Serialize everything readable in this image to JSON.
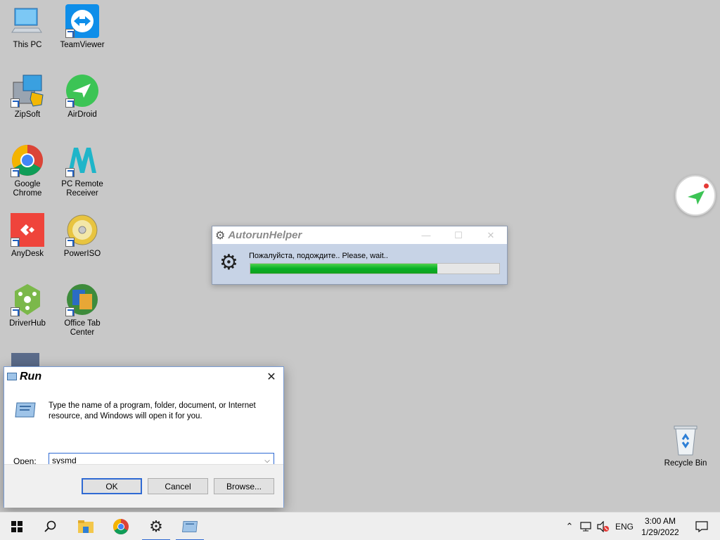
{
  "desktop": {
    "icons": [
      {
        "label": "This PC"
      },
      {
        "label": "TeamViewer"
      },
      {
        "label": "ZipSoft"
      },
      {
        "label": "AirDroid"
      },
      {
        "label": "Google Chrome"
      },
      {
        "label": "PC Remote Receiver"
      },
      {
        "label": "AnyDesk"
      },
      {
        "label": "PowerISO"
      },
      {
        "label": "DriverHub"
      },
      {
        "label": "Office Tab Center"
      },
      {
        "label": "Recycle Bin"
      }
    ]
  },
  "autorun": {
    "title": "AutorunHelper",
    "message": "Пожалуйста, подождите.. Please, wait..",
    "progress": 0.75,
    "progress_color": "#06b025"
  },
  "run_dialog": {
    "title": "Run",
    "description": "Type the name of a program, folder, document, or Internet resource, and Windows will open it for you.",
    "open_label": "Open:",
    "open_value": "sysmd",
    "ok_label": "OK",
    "cancel_label": "Cancel",
    "browse_label": "Browse..."
  },
  "taskbar": {
    "language": "ENG",
    "time": "3:00 AM",
    "date": "1/29/2022",
    "pinned": [
      "start-icon",
      "search-icon",
      "file-explorer-icon",
      "chrome-icon",
      "autorun-helper-icon",
      "run-icon"
    ]
  },
  "colors": {
    "desktop_bg": "#c8c8c8",
    "accent": "#2f6ad3"
  }
}
